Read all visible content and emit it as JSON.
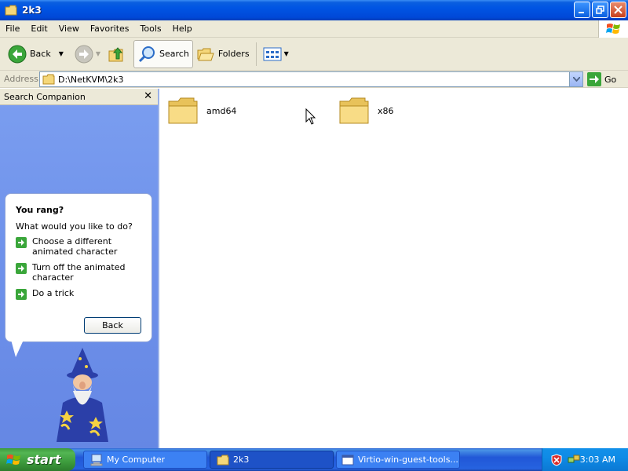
{
  "window": {
    "title": "2k3",
    "controls": [
      "minimize",
      "maximize",
      "close"
    ]
  },
  "menubar": {
    "items": [
      "File",
      "Edit",
      "View",
      "Favorites",
      "Tools",
      "Help"
    ]
  },
  "toolbar": {
    "back_label": "Back",
    "search_label": "Search",
    "folders_label": "Folders"
  },
  "address": {
    "label": "Address",
    "value": "D:\\NetKVM\\2k3",
    "go_label": "Go"
  },
  "side_pane": {
    "title": "Search Companion",
    "bubble_title": "You rang?",
    "question": "What would you like to do?",
    "options": [
      "Choose a different animated character",
      "Turn off the animated character",
      "Do a trick"
    ],
    "back_label": "Back"
  },
  "files": [
    {
      "name": "amd64",
      "icon": "folder-icon"
    },
    {
      "name": "x86",
      "icon": "folder-icon"
    }
  ],
  "taskbar": {
    "start_label": "start",
    "tasks": [
      {
        "label": "My Computer",
        "icon": "my-computer-icon"
      },
      {
        "label": "2k3",
        "icon": "folder-icon"
      },
      {
        "label": "Virtio-win-guest-tools...",
        "icon": "window-icon"
      }
    ],
    "clock": "3:03 AM"
  },
  "colors": {
    "titlebar": "#0054e3",
    "chrome": "#ece9d8",
    "sidepane": "#7b9ef0",
    "taskbar": "#2157d7",
    "start": "#3d9c3d"
  }
}
